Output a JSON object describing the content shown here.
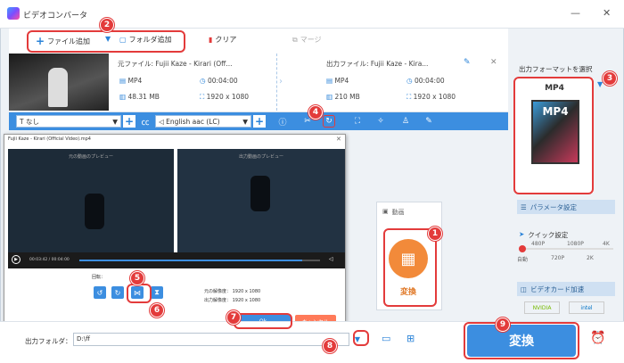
{
  "app": {
    "title": "ビデオコンバータ"
  },
  "toolbar": {
    "add_file": "ファイル追加",
    "add_folder": "フォルダ追加",
    "clear": "クリア",
    "merge": "マージ"
  },
  "file": {
    "source_label": "元ファイル: Fujii Kaze - Kirari (Off...",
    "output_label": "出力ファイル: Fujii Kaze - Kira...",
    "src_format": "MP4",
    "src_duration": "00:04:00",
    "src_size": "48.31 MB",
    "src_resolution": "1920 x 1080",
    "out_format": "MP4",
    "out_duration": "00:04:00",
    "out_size": "210 MB",
    "out_resolution": "1920 x 1080"
  },
  "options": {
    "subtitle": "なし",
    "audio": "English aac (LC)"
  },
  "dialog": {
    "title": "Fujii Kaze - Kirari (Official Video).mp4",
    "left_preview": "元の動画のプレビュー",
    "right_preview": "出力動画のプレビュー",
    "time": "00:03:42 / 00:04:00",
    "rotate_label": "回転：",
    "orig_res": "元の解像度： 1920 x 1080",
    "out_res": "出力解像度： 1920 x 1080",
    "ok": "Ok",
    "cancel": "キャンセル",
    "playback_progress": 0.925
  },
  "right_panel": {
    "format_select": "出力フォーマットを選択",
    "format": "MP4",
    "param": "パラメータ設定",
    "quick": "クイック設定",
    "ticks_top": [
      "480P",
      "1080P",
      "4K"
    ],
    "ticks_bottom": [
      "自動",
      "720P",
      "2K"
    ],
    "gpu": "ビデオカード加速",
    "nvidia": "NVIDIA",
    "intel": "intel"
  },
  "tile": {
    "header": "動画",
    "label": "変換"
  },
  "bottom": {
    "folder_label": "出力フォルダ：",
    "folder_value": "D:\\ff",
    "convert": "変換"
  },
  "badges": [
    "1",
    "2",
    "3",
    "4",
    "5",
    "6",
    "7",
    "8",
    "9"
  ],
  "colors": {
    "accent": "#3c8ee0",
    "badge": "#e33b3b",
    "cancel": "#ff7a59",
    "convert_tile": "#f28a3a"
  }
}
